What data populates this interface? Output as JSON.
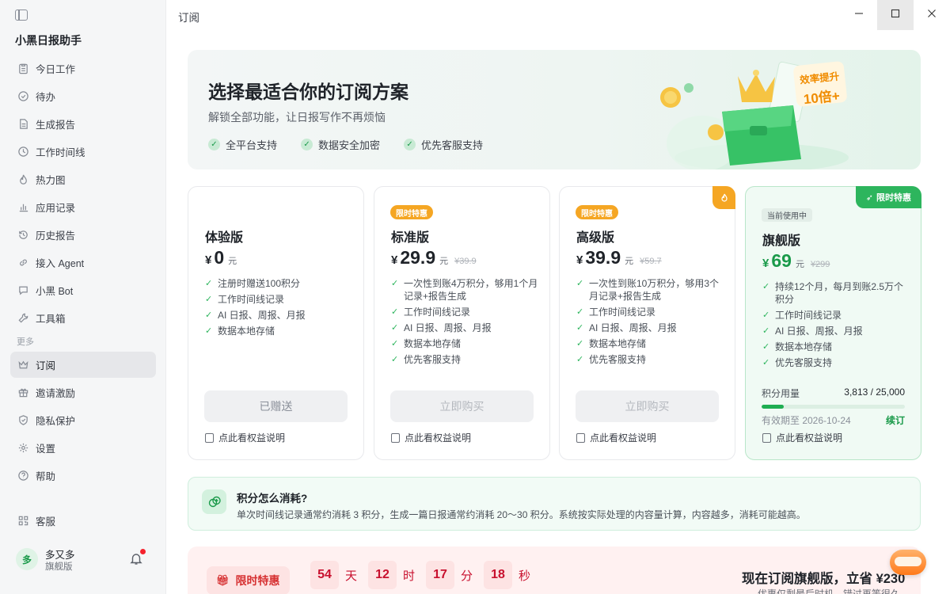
{
  "sidebar": {
    "app_title": "小黑日报助手",
    "items": [
      {
        "label": "今日工作",
        "icon": "clipboard-icon"
      },
      {
        "label": "待办",
        "icon": "check-circle-icon"
      },
      {
        "label": "生成报告",
        "icon": "document-icon"
      },
      {
        "label": "工作时间线",
        "icon": "clock-icon"
      },
      {
        "label": "热力图",
        "icon": "flame-icon"
      },
      {
        "label": "应用记录",
        "icon": "bar-chart-icon"
      },
      {
        "label": "历史报告",
        "icon": "history-icon"
      },
      {
        "label": "接入 Agent",
        "icon": "link-icon"
      },
      {
        "label": "小黑 Bot",
        "icon": "chat-icon"
      },
      {
        "label": "工具箱",
        "icon": "wrench-icon"
      }
    ],
    "section_more": "更多",
    "more_items": [
      {
        "label": "订阅",
        "icon": "crown-icon",
        "active": true
      },
      {
        "label": "邀请激励",
        "icon": "gift-icon"
      },
      {
        "label": "隐私保护",
        "icon": "shield-icon"
      },
      {
        "label": "设置",
        "icon": "gear-icon"
      },
      {
        "label": "帮助",
        "icon": "help-icon"
      }
    ],
    "service": {
      "label": "客服",
      "icon": "qr-icon"
    },
    "user": {
      "avatar": "多",
      "name": "多又多",
      "plan": "旗舰版"
    }
  },
  "page": {
    "title": "订阅"
  },
  "hero": {
    "title": "选择最适合你的订阅方案",
    "subtitle": "解锁全部功能，让日报写作不再烦恼",
    "features": [
      "全平台支持",
      "数据安全加密",
      "优先客服支持"
    ],
    "badge_line1": "效率提升",
    "badge_line2": "10倍+"
  },
  "plans": [
    {
      "name": "体验版",
      "currency": "¥",
      "price": "0",
      "unit": "元",
      "orig": "",
      "features": [
        "注册时赠送100积分",
        "工作时间线记录",
        "AI 日报、周报、月报",
        "数据本地存储"
      ],
      "button": "已赠送",
      "benefit": "点此看权益说明"
    },
    {
      "name": "标准版",
      "tag": "限时特惠",
      "currency": "¥",
      "price": "29.9",
      "unit": "元",
      "orig": "¥39.9",
      "features": [
        "一次性到账4万积分，够用1个月记录+报告生成",
        "工作时间线记录",
        "AI 日报、周报、月报",
        "数据本地存储",
        "优先客服支持"
      ],
      "button": "立即购买",
      "benefit": "点此看权益说明"
    },
    {
      "name": "高级版",
      "tag": "限时特惠",
      "currency": "¥",
      "price": "39.9",
      "unit": "元",
      "orig": "¥59.7",
      "features": [
        "一次性到账10万积分，够用3个月记录+报告生成",
        "工作时间线记录",
        "AI 日报、周报、月报",
        "数据本地存储",
        "优先客服支持"
      ],
      "button": "立即购买",
      "benefit": "点此看权益说明"
    },
    {
      "name": "旗舰版",
      "tag": "当前使用中",
      "corner": "限时特惠",
      "currency": "¥",
      "price": "69",
      "unit": "元",
      "orig": "¥299",
      "features": [
        "持续12个月，每月到账2.5万个积分",
        "工作时间线记录",
        "AI 日报、周报、月报",
        "数据本地存储",
        "优先客服支持"
      ],
      "quota_label": "积分用量",
      "quota_value": "3,813 / 25,000",
      "quota_fraction": 0.1525,
      "expiry": "有效期至 2026-10-24",
      "renew": "续订",
      "benefit": "点此看权益说明"
    }
  ],
  "info": {
    "title": "积分怎么消耗?",
    "text": "单次时间线记录通常约消耗 3 积分，生成一篇日报通常约消耗 20～30 积分。系统按实际处理的内容量计算，内容越多，消耗可能越高。"
  },
  "promo": {
    "tag": "限时特惠",
    "countdown": [
      {
        "num": "54",
        "unit": "天"
      },
      {
        "num": "12",
        "unit": "时"
      },
      {
        "num": "17",
        "unit": "分"
      },
      {
        "num": "18",
        "unit": "秒"
      }
    ],
    "title": "现在订阅旗舰版，立省 ¥230",
    "subtitle": "优惠仅剩最后时机，错过再等很久"
  },
  "colors": {
    "accent_green": "#2db55d",
    "sale_orange": "#f5a623",
    "promo_red": "#c8102e"
  }
}
